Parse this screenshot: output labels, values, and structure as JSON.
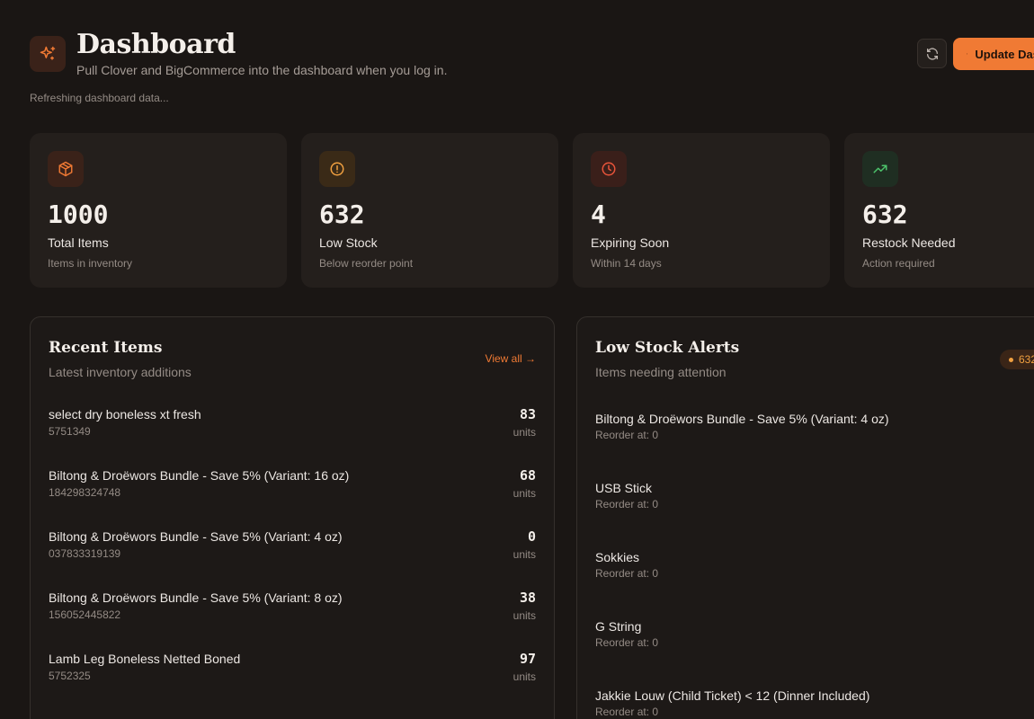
{
  "header": {
    "title": "Dashboard",
    "subtitle": "Pull Clover and BigCommerce into the dashboard when you log in.",
    "status": "Refreshing dashboard data...",
    "update_label": "Update Dashboard"
  },
  "stats": [
    {
      "value": "1000",
      "label": "Total Items",
      "desc": "Items in inventory",
      "icon": "box-icon",
      "color": "#f07a34"
    },
    {
      "value": "632",
      "label": "Low Stock",
      "desc": "Below reorder point",
      "icon": "alert-circle-icon",
      "color": "#f0a040"
    },
    {
      "value": "4",
      "label": "Expiring Soon",
      "desc": "Within 14 days",
      "icon": "clock-icon",
      "color": "#e8543a"
    },
    {
      "value": "632",
      "label": "Restock Needed",
      "desc": "Action required",
      "icon": "trending-up-icon",
      "color": "#4cc36b"
    }
  ],
  "recent": {
    "title": "Recent Items",
    "subtitle": "Latest inventory additions",
    "view_all": "View all →",
    "items": [
      {
        "name": "select dry boneless xt fresh",
        "sku": "5751349",
        "qty": "83",
        "unit": "units"
      },
      {
        "name": "Biltong & Droëwors Bundle - Save 5% (Variant: 16 oz)",
        "sku": "184298324748",
        "qty": "68",
        "unit": "units"
      },
      {
        "name": "Biltong & Droëwors Bundle - Save 5% (Variant: 4 oz)",
        "sku": "037833319139",
        "qty": "0",
        "unit": "units"
      },
      {
        "name": "Biltong & Droëwors Bundle - Save 5% (Variant: 8 oz)",
        "sku": "156052445822",
        "qty": "38",
        "unit": "units"
      },
      {
        "name": "Lamb Leg Boneless Netted Boned",
        "sku": "5752325",
        "qty": "97",
        "unit": "units"
      }
    ]
  },
  "alerts": {
    "title": "Low Stock Alerts",
    "subtitle": "Items needing attention",
    "badge": "632",
    "items": [
      {
        "name": "Biltong & Droëwors Bundle - Save 5% (Variant: 4 oz)",
        "reorder": "Reorder at: 0"
      },
      {
        "name": "USB Stick",
        "reorder": "Reorder at: 0"
      },
      {
        "name": "Sokkies",
        "reorder": "Reorder at: 0"
      },
      {
        "name": "G String",
        "reorder": "Reorder at: 0"
      },
      {
        "name": "Jakkie Louw (Child Ticket) < 12 (Dinner Included)",
        "reorder": "Reorder at: 0"
      }
    ]
  },
  "colors": {
    "accent": "#f07a34",
    "background": "#1a1614",
    "card": "#241f1c"
  }
}
